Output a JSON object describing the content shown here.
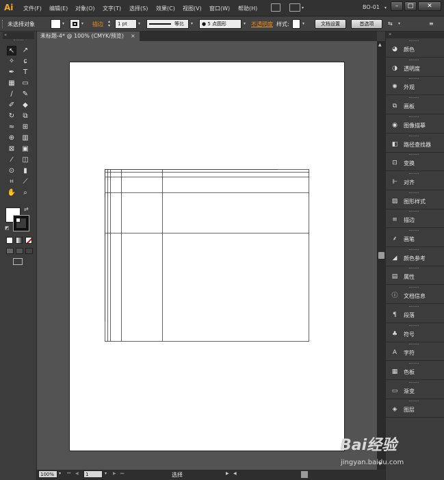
{
  "app": {
    "logo": "Ai",
    "workspace": "BO-01"
  },
  "menu": [
    {
      "label": "文件(F)"
    },
    {
      "label": "编辑(E)"
    },
    {
      "label": "对象(O)"
    },
    {
      "label": "文字(T)"
    },
    {
      "label": "选择(S)"
    },
    {
      "label": "效果(C)"
    },
    {
      "label": "视图(V)"
    },
    {
      "label": "窗口(W)"
    },
    {
      "label": "帮助(H)"
    }
  ],
  "control": {
    "selection_status": "未选择对象",
    "stroke_label": "描边",
    "stroke_weight": "1 pt",
    "stroke_profile": "等比",
    "brush": "5 点圆形",
    "opacity_label": "不透明度",
    "style_label": "样式:",
    "doc_setup_button": "文档设置",
    "preferences_button": "首选项"
  },
  "document": {
    "tab_title": "未标题-4* @ 100% (CMYK/预览)",
    "close": "×"
  },
  "status": {
    "zoom": "100%",
    "page": "1",
    "tool": "选择"
  },
  "panels": [
    {
      "label": "颜色",
      "icon": "color-icon"
    },
    {
      "label": "透明度",
      "icon": "transparency-icon"
    },
    {
      "label": "外观",
      "icon": "appearance-icon"
    },
    {
      "label": "画板",
      "icon": "artboards-icon"
    },
    {
      "label": "图像描摹",
      "icon": "image-trace-icon"
    },
    {
      "label": "路径查找器",
      "icon": "pathfinder-icon"
    },
    {
      "label": "变换",
      "icon": "transform-icon"
    },
    {
      "label": "对齐",
      "icon": "align-icon"
    },
    {
      "label": "图形样式",
      "icon": "graphic-styles-icon"
    },
    {
      "label": "描边",
      "icon": "stroke-icon"
    },
    {
      "label": "画笔",
      "icon": "brushes-icon"
    },
    {
      "label": "颜色参考",
      "icon": "color-guide-icon"
    },
    {
      "label": "属性",
      "icon": "attributes-icon"
    },
    {
      "label": "文档信息",
      "icon": "document-info-icon"
    },
    {
      "label": "段落",
      "icon": "paragraph-icon"
    },
    {
      "label": "符号",
      "icon": "symbols-icon"
    },
    {
      "label": "字符",
      "icon": "character-icon"
    },
    {
      "label": "色板",
      "icon": "swatches-icon"
    },
    {
      "label": "渐变",
      "icon": "gradient-icon"
    },
    {
      "label": "图层",
      "icon": "layers-icon"
    }
  ],
  "colors": {
    "accent_orange": "#e98c1f",
    "canvas": "#535353",
    "ui": "#3c3c3c"
  },
  "watermark": {
    "brand": "Bai经验",
    "url": "jingyan.baidu.com"
  }
}
